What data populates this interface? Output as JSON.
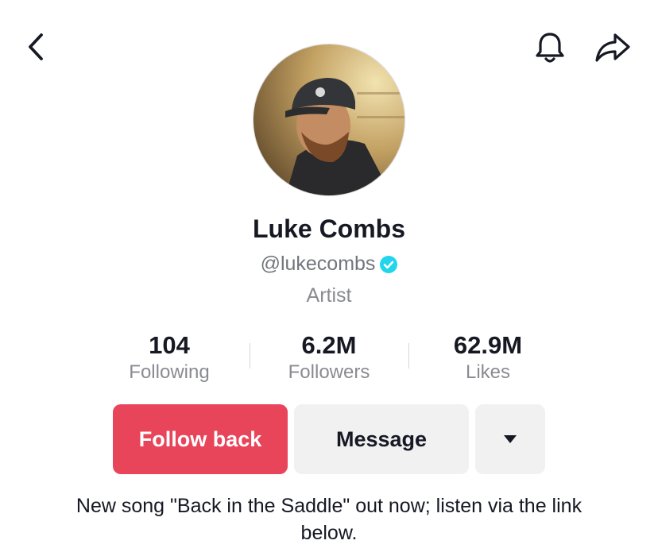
{
  "header": {
    "back_icon": "chevron-left-icon",
    "notification_icon": "bell-icon",
    "share_icon": "share-arrow-icon"
  },
  "profile": {
    "name": "Luke Combs",
    "handle": "@lukecombs",
    "verified": true,
    "category": "Artist",
    "avatar_alt": "profile-photo"
  },
  "stats": [
    {
      "value": "104",
      "label": "Following"
    },
    {
      "value": "6.2M",
      "label": "Followers"
    },
    {
      "value": "62.9M",
      "label": "Likes"
    }
  ],
  "actions": {
    "follow_label": "Follow back",
    "message_label": "Message",
    "more_icon": "caret-down-icon"
  },
  "bio": "New song \"Back in the Saddle\" out now; listen via the link below.",
  "colors": {
    "accent": "#e9455a",
    "verified": "#20d5ec",
    "secondary_text": "#8a8b91",
    "button_gray": "#f1f1f2"
  }
}
